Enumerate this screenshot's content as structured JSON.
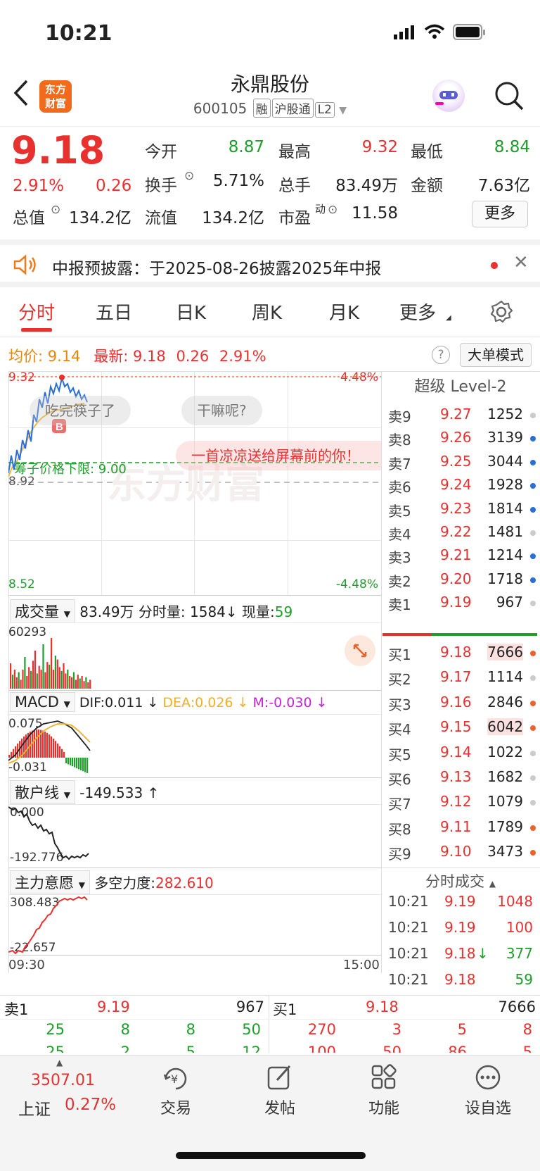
{
  "status": {
    "time": "10:21"
  },
  "header": {
    "name": "永鼎股份",
    "code": "600105",
    "tags": [
      "融",
      "沪股通",
      "L2"
    ],
    "logo_line1": "东方",
    "logo_line2": "财富"
  },
  "quote": {
    "price": "9.18",
    "pct": "2.91%",
    "chg": "0.26",
    "open_label": "今开",
    "open": "8.87",
    "high_label": "最高",
    "high": "9.32",
    "low_label": "最低",
    "low": "8.84",
    "turnover_label": "换手",
    "turnover": "5.71%",
    "volume_label": "总手",
    "volume": "83.49万",
    "amount_label": "金额",
    "amount": "7.63亿",
    "mcap_label": "总值",
    "mcap": "134.2亿",
    "float_label": "流值",
    "float": "134.2亿",
    "pe_label": "市盈",
    "pe_sup": "动",
    "pe": "11.58",
    "more": "更多"
  },
  "notice": {
    "text": "中报预披露：于2025-08-26披露2025年中报"
  },
  "tabs": [
    "分时",
    "五日",
    "日K",
    "周K",
    "月K",
    "更多"
  ],
  "intraday": {
    "avg_label": "均价:",
    "avg": "9.14",
    "last_label": "最新:",
    "last": "9.18",
    "chg": "0.26",
    "pct": "2.91%",
    "mode_btn": "大单模式",
    "y_top": "9.32",
    "y_bottom": "8.52",
    "pct_top": "4.48%",
    "pct_bottom": "-4.48%",
    "prev_close": "8.92",
    "limit_line": "筹子价格下限: 9.00",
    "barrage1": "吃完筷子了",
    "barrage2": "干嘛呢?",
    "barrage3": "一首凉凉送给屏幕前的你！",
    "watermark": "东方财富",
    "buy_marker": "B"
  },
  "volume_panel": {
    "label": "成交量",
    "total": "83.49万",
    "detail": "分时量: 1584",
    "arrow": "↓",
    "now_label": "现量:",
    "now": "59",
    "ymax": "60293"
  },
  "macd_panel": {
    "label": "MACD",
    "dif": "DIF:0.011 ↓",
    "dea": "DEA:0.026 ↓",
    "m": "M:-0.030 ↓",
    "ymax": "0.075",
    "ymin": "-0.031"
  },
  "retail_panel": {
    "label": "散户线",
    "value": "-149.533 ↑",
    "ymax": "0.000",
    "ymin": "-192.776"
  },
  "main_panel": {
    "label": "主力意愿",
    "force_label": "多空力度:",
    "force": "282.610",
    "ymax": "308.483",
    "ymin": "-22.657",
    "t_start": "09:30",
    "t_end": "15:00"
  },
  "orderbook": {
    "title": "超级 Level-2",
    "asks": [
      {
        "l": "卖9",
        "p": "9.27",
        "v": "1252",
        "c": "#cccccc"
      },
      {
        "l": "卖8",
        "p": "9.26",
        "v": "3139",
        "c": "#2b6fd6"
      },
      {
        "l": "卖7",
        "p": "9.25",
        "v": "3044",
        "c": "#2b6fd6"
      },
      {
        "l": "卖6",
        "p": "9.24",
        "v": "1928",
        "c": "#2b6fd6"
      },
      {
        "l": "卖5",
        "p": "9.23",
        "v": "1814",
        "c": "#2b6fd6"
      },
      {
        "l": "卖4",
        "p": "9.22",
        "v": "1481",
        "c": "#cccccc"
      },
      {
        "l": "卖3",
        "p": "9.21",
        "v": "1214",
        "c": "#2b6fd6"
      },
      {
        "l": "卖2",
        "p": "9.20",
        "v": "1718",
        "c": "#2b6fd6"
      },
      {
        "l": "卖1",
        "p": "9.19",
        "v": "967",
        "c": "#cccccc"
      }
    ],
    "bids": [
      {
        "l": "买1",
        "p": "9.18",
        "v": "7666",
        "c": "#e8642f"
      },
      {
        "l": "买2",
        "p": "9.17",
        "v": "1114",
        "c": "#cccccc"
      },
      {
        "l": "买3",
        "p": "9.16",
        "v": "2846",
        "c": "#e8642f"
      },
      {
        "l": "买4",
        "p": "9.15",
        "v": "6042",
        "c": "#e8642f"
      },
      {
        "l": "买5",
        "p": "9.14",
        "v": "1022",
        "c": "#cccccc"
      },
      {
        "l": "买6",
        "p": "9.13",
        "v": "1682",
        "c": "#cccccc"
      },
      {
        "l": "买7",
        "p": "9.12",
        "v": "1079",
        "c": "#cccccc"
      },
      {
        "l": "买8",
        "p": "9.11",
        "v": "1789",
        "c": "#e8642f"
      },
      {
        "l": "买9",
        "p": "9.10",
        "v": "3473",
        "c": "#e8642f"
      }
    ]
  },
  "trades": {
    "title": "分时成交",
    "rows": [
      {
        "t": "10:21",
        "p": "9.19",
        "v": "1048",
        "a": ""
      },
      {
        "t": "10:21",
        "p": "9.19",
        "v": "100",
        "a": ""
      },
      {
        "t": "10:21",
        "p": "9.18",
        "v": "377",
        "a": "↓"
      },
      {
        "t": "10:21",
        "p": "9.18",
        "v": "59",
        "a": ""
      }
    ]
  },
  "bottom_quote": {
    "ask_label": "卖1",
    "ask_price": "9.19",
    "ask_vol": "967",
    "bid_label": "买1",
    "bid_price": "9.18",
    "bid_vol": "7666",
    "ask_q1": [
      "25",
      "8",
      "8",
      "50"
    ],
    "ask_q2": [
      "25",
      "2",
      "5",
      "12"
    ],
    "bid_q1": [
      "270",
      "3",
      "5",
      "8"
    ],
    "bid_q2": [
      "100",
      "50",
      "86",
      "5"
    ]
  },
  "bottom_bar": {
    "index_value": "3507.01",
    "index_name": "上证",
    "index_pct": "0.27%",
    "items": [
      "交易",
      "发帖",
      "功能",
      "设自选"
    ]
  }
}
